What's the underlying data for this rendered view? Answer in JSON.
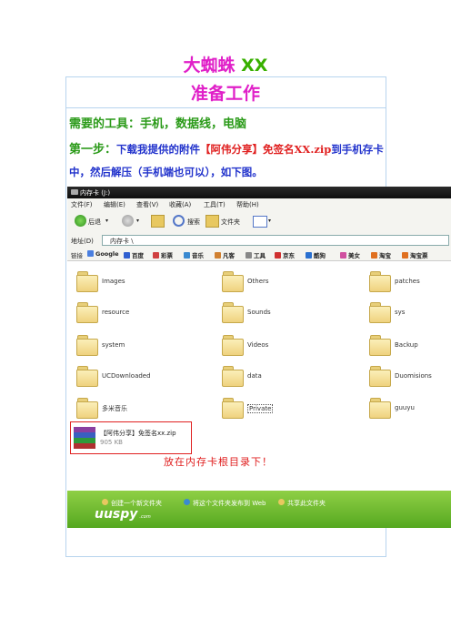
{
  "heading": {
    "title_cn": "大蜘蛛",
    "title_xx": "XX"
  },
  "section": {
    "title": "准备工作"
  },
  "tools_line": "需要的工具：手机，数据线，电脑",
  "step": {
    "label": "第一步：",
    "text1": "下载我提供的附件",
    "highlight": "【阿伟分享】免签名XX.zip",
    "text2": "到手机存卡中，然后解压（手机端也可以），如下图。"
  },
  "explorer": {
    "title": "内存卡 (J:)",
    "menu": [
      "文件(F)",
      "编辑(E)",
      "查看(V)",
      "收藏(A)",
      "工具(T)",
      "帮助(H)"
    ],
    "toolbar": {
      "back": "后退",
      "search": "搜索",
      "folders": "文件夹"
    },
    "address_label": "地址(D)",
    "address_value": "内存卡 \\",
    "links_label": "链接",
    "links": [
      "Google",
      "百度",
      "彩票",
      "音乐",
      "凡客",
      "工具",
      "京东",
      "酷狗",
      "美女",
      "淘宝",
      "淘宝票"
    ],
    "folders_col1": [
      "Images",
      "resource",
      "system",
      "UCDownloaded",
      "多米音乐"
    ],
    "folders_col2": [
      "Others",
      "Sounds",
      "Videos",
      "data",
      "Private"
    ],
    "folders_col3": [
      "patches",
      "sys",
      "Backup",
      "Duomisions",
      "guuyu"
    ],
    "zip_name": "【阿伟分享】免签名xx.zip",
    "zip_size": "905 KB",
    "note": "放在内存卡根目录下！",
    "status_items": [
      "创建一个新文件夹",
      "将这个文件夹发布到 Web",
      "共享此文件夹"
    ],
    "watermark": "uuspy",
    "watermark_sub": ".com"
  },
  "colors": {
    "magenta": "#e020c8",
    "green": "#2a9a18",
    "blue": "#2233cc",
    "red": "#e02020"
  }
}
